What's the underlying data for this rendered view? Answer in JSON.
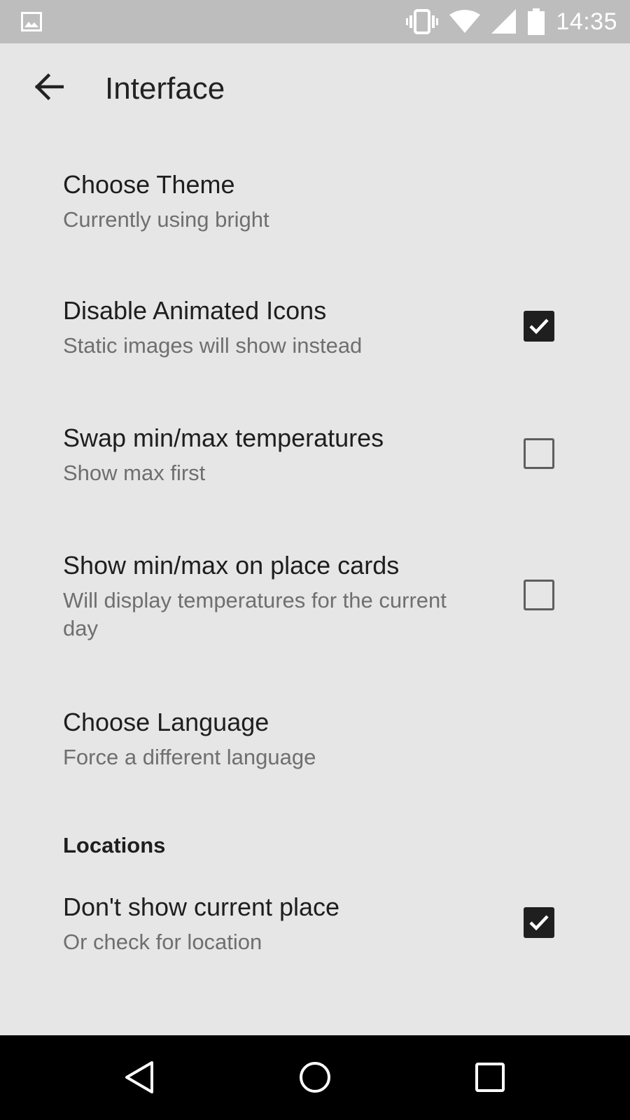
{
  "status_bar": {
    "time": "14:35",
    "icons": [
      "image-notification-icon",
      "vibrate-icon",
      "wifi-icon",
      "signal-icon",
      "battery-icon"
    ]
  },
  "toolbar": {
    "title": "Interface",
    "back_icon": "arrow-left-icon"
  },
  "preferences": [
    {
      "title": "Choose Theme",
      "summary": "Currently using bright"
    },
    {
      "title": "Disable Animated Icons",
      "summary": "Static images will show instead",
      "checked": true
    },
    {
      "title": "Swap min/max temperatures",
      "summary": "Show max first",
      "checked": false
    },
    {
      "title": "Show min/max on place cards",
      "summary": "Will display temperatures for the current day",
      "checked": false
    },
    {
      "title": "Choose Language",
      "summary": "Force a different language"
    }
  ],
  "locations": {
    "header": "Locations",
    "items": [
      {
        "title": "Don't show current place",
        "summary": "Or check for location",
        "checked": true
      }
    ]
  },
  "nav_bar": {
    "icons": [
      "back-triangle-icon",
      "home-circle-icon",
      "recents-square-icon"
    ]
  },
  "colors": {
    "background": "#e6e6e6",
    "status_bar": "#bdbdbd",
    "nav_bar": "#000000",
    "checkbox_checked": "#1f1f1f"
  }
}
